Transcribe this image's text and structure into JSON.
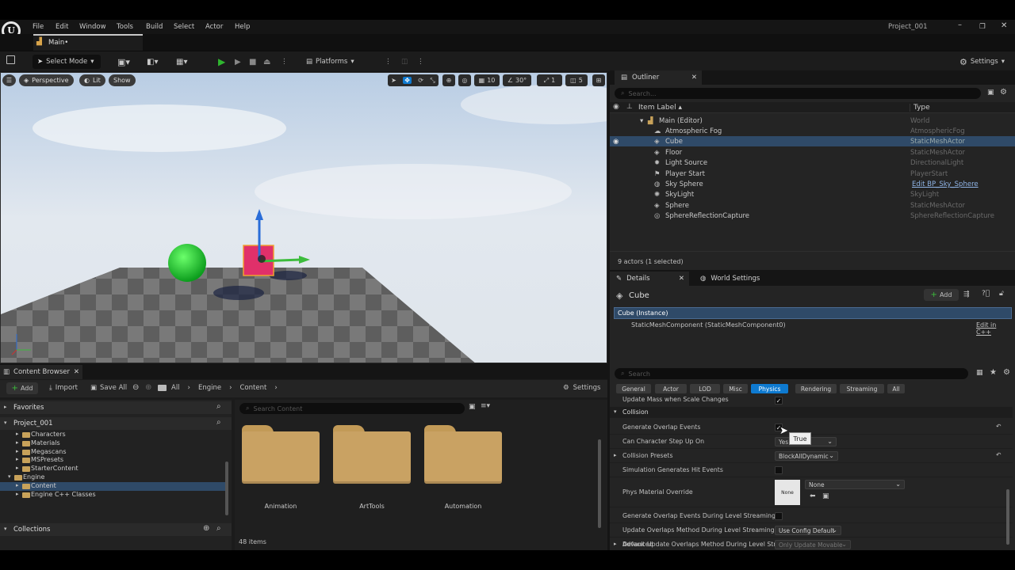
{
  "menu": [
    "File",
    "Edit",
    "Window",
    "Tools",
    "Build",
    "Select",
    "Actor",
    "Help"
  ],
  "project_name": "Project_001",
  "level_tab": "Main•",
  "toolbar": {
    "select_mode": "Select Mode",
    "platforms": "Platforms",
    "settings": "Settings"
  },
  "viewport": {
    "perspective": "Perspective",
    "lit": "Lit",
    "show": "Show",
    "grid_size": "10",
    "rotation_snap": "30°",
    "scale_snap": "1",
    "camera_speed": "5"
  },
  "outliner": {
    "title": "Outliner",
    "search_placeholder": "Search...",
    "col_label": "Item Label ▴",
    "col_type": "Type",
    "root": {
      "label": "Main (Editor)",
      "type": "World"
    },
    "items": [
      {
        "label": "Atmospheric Fog",
        "type": "AtmosphericFog",
        "icon": "fog-icon"
      },
      {
        "label": "Cube",
        "type": "StaticMeshActor",
        "icon": "mesh-icon",
        "selected": true
      },
      {
        "label": "Floor",
        "type": "StaticMeshActor",
        "icon": "mesh-icon"
      },
      {
        "label": "Light Source",
        "type": "DirectionalLight",
        "icon": "light-icon"
      },
      {
        "label": "Player Start",
        "type": "PlayerStart",
        "icon": "player-start-icon"
      },
      {
        "label": "Sky Sphere",
        "type": "Edit BP_Sky_Sphere",
        "icon": "sky-icon",
        "link": true
      },
      {
        "label": "SkyLight",
        "type": "SkyLight",
        "icon": "skylight-icon"
      },
      {
        "label": "Sphere",
        "type": "StaticMeshActor",
        "icon": "mesh-icon"
      },
      {
        "label": "SphereReflectionCapture",
        "type": "SphereReflectionCapture",
        "icon": "reflection-icon"
      }
    ],
    "status": "9 actors (1 selected)"
  },
  "details": {
    "tab": "Details",
    "world_settings_tab": "World Settings",
    "object_name": "Cube",
    "add_label": "Add",
    "instance": "Cube (Instance)",
    "component": "StaticMeshComponent (StaticMeshComponent0)",
    "edit_cpp": "Edit in C++",
    "search_placeholder": "Search",
    "categories": [
      "General",
      "Actor",
      "LOD",
      "Misc",
      "Physics",
      "Rendering",
      "Streaming",
      "All"
    ],
    "active_category": "Physics",
    "update_mass": "Update Mass when Scale Changes",
    "collision_header": "Collision",
    "props": {
      "generate_overlap": "Generate Overlap Events",
      "can_step_up": "Can Character Step Up On",
      "can_step_up_value": "Yes",
      "collision_presets": "Collision Presets",
      "collision_presets_value": "BlockAllDynamic",
      "sim_hit_events": "Simulation Generates Hit Events",
      "phys_material": "Phys Material Override",
      "phys_thumb": "None",
      "phys_value": "None",
      "overlap_streaming": "Generate Overlap Events During Level Streaming",
      "update_overlaps": "Update Overlaps Method During Level Streaming",
      "update_overlaps_value": "Use Config Default",
      "default_update": "Default Update Overlaps Method During Level Strea...",
      "default_update_value": "Only Update Movable",
      "advanced": "Advanced"
    },
    "tooltip": "True"
  },
  "content_browser": {
    "title": "Content Browser",
    "add": "Add",
    "import": "Import",
    "save_all": "Save All",
    "breadcrumb": [
      "All",
      "Engine",
      "Content"
    ],
    "settings": "Settings",
    "favorites": "Favorites",
    "project": "Project_001",
    "search_placeholder": "Search Content",
    "tree": [
      {
        "label": "Characters",
        "depth": 1
      },
      {
        "label": "Materials",
        "depth": 1
      },
      {
        "label": "Megascans",
        "depth": 1
      },
      {
        "label": "MSPresets",
        "depth": 1
      },
      {
        "label": "StarterContent",
        "depth": 1
      },
      {
        "label": "Engine",
        "depth": 0
      },
      {
        "label": "Content",
        "depth": 1,
        "selected": true
      },
      {
        "label": "Engine C++ Classes",
        "depth": 1
      }
    ],
    "collections": "Collections",
    "folders": [
      "Animation",
      "ArtTools",
      "Automation"
    ],
    "item_count": "48 items"
  },
  "colors": {
    "accent": "#0e7ad0",
    "selected_row": "#2f4a68",
    "folder": "#c9a263"
  }
}
